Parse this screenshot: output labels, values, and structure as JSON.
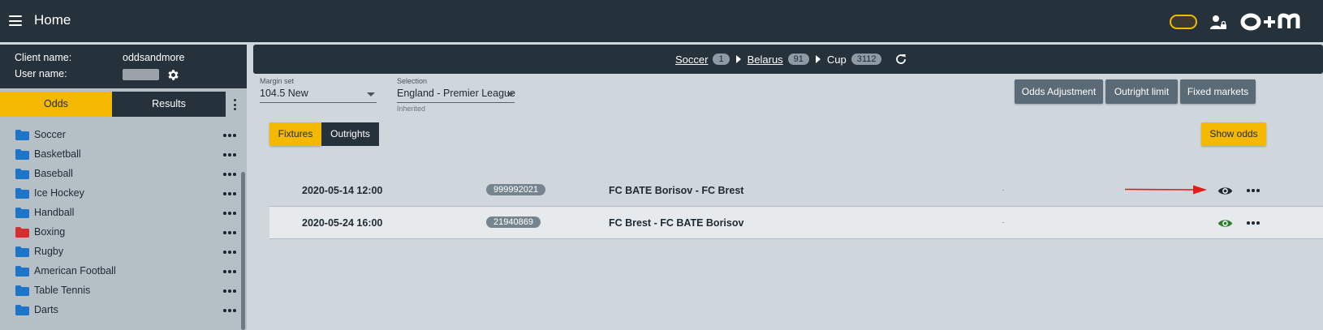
{
  "header": {
    "title": "Home",
    "menu_icon": "hamburger-icon",
    "user_icon": "user-lock-icon",
    "logo": "o+m"
  },
  "sidebar": {
    "client_label": "Client name:",
    "client_value": "oddsandmore",
    "user_label": "User name:",
    "tabs": [
      {
        "label": "Odds",
        "active": true
      },
      {
        "label": "Results",
        "active": false
      }
    ],
    "sports": [
      {
        "label": "Soccer",
        "folder_color": "#1e74c6"
      },
      {
        "label": "Basketball",
        "folder_color": "#1e74c6"
      },
      {
        "label": "Baseball",
        "folder_color": "#1e74c6"
      },
      {
        "label": "Ice Hockey",
        "folder_color": "#1e74c6"
      },
      {
        "label": "Handball",
        "folder_color": "#1e74c6"
      },
      {
        "label": "Boxing",
        "folder_color": "#d32f2f"
      },
      {
        "label": "Rugby",
        "folder_color": "#1e74c6"
      },
      {
        "label": "American Football",
        "folder_color": "#1e74c6"
      },
      {
        "label": "Table Tennis",
        "folder_color": "#1e74c6"
      },
      {
        "label": "Darts",
        "folder_color": "#1e74c6"
      }
    ]
  },
  "breadcrumb": {
    "items": [
      {
        "label": "Soccer",
        "count": "1",
        "link": true
      },
      {
        "label": "Belarus",
        "count": "91",
        "link": true
      },
      {
        "label": "Cup",
        "count": "3112",
        "link": false
      }
    ]
  },
  "filters": {
    "margin_label": "Margin set",
    "margin_value": "104.5 New",
    "selection_label": "Selection",
    "selection_value": "England - Premier League",
    "selection_note": "Inherited"
  },
  "actions": {
    "odds_adjustment": "Odds Adjustment",
    "outright_limit": "Outright limit",
    "fixed_markets": "Fixed markets",
    "show_odds": "Show odds"
  },
  "view_tabs": {
    "fixtures": "Fixtures",
    "outrights": "Outrights"
  },
  "fixtures": [
    {
      "date": "2020-05-14 12:00",
      "id": "999992021",
      "name": "FC BATE Borisov - FC Brest",
      "eye_color": "#1e2a33"
    },
    {
      "date": "2020-05-24 16:00",
      "id": "21940869",
      "name": "FC Brest - FC BATE Borisov",
      "eye_color": "#2e7d32"
    }
  ],
  "colors": {
    "accent": "#f5b800",
    "dark": "#26323b",
    "annotation_arrow": "#e31b1b"
  }
}
